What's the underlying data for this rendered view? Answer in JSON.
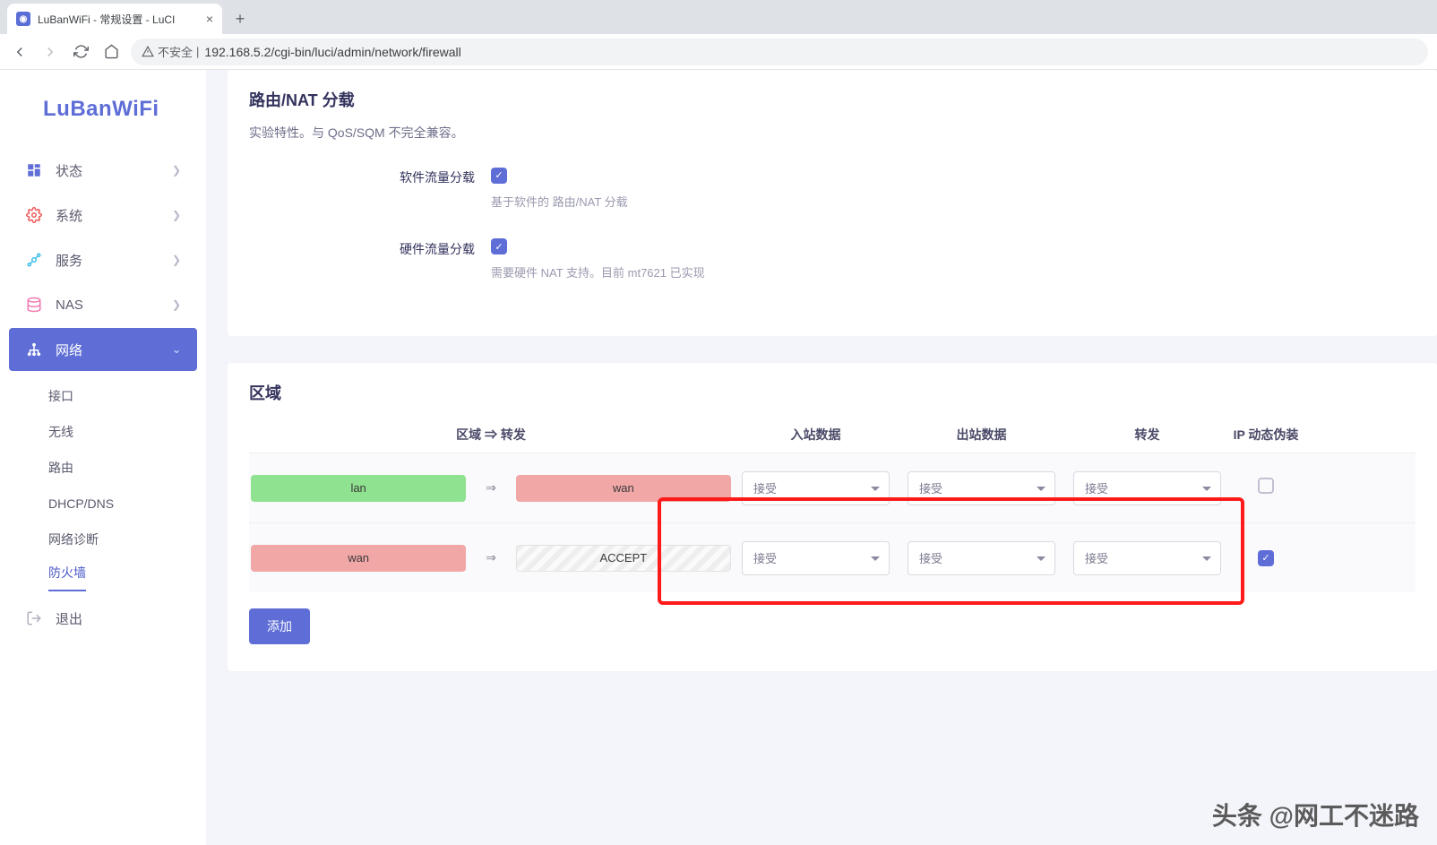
{
  "browser": {
    "tab_title": "LuBanWiFi - 常规设置 - LuCI",
    "insecure_label": "不安全",
    "url": "192.168.5.2/cgi-bin/luci/admin/network/firewall"
  },
  "app": {
    "logo": "LuBanWiFi",
    "menu": {
      "status": "状态",
      "system": "系统",
      "services": "服务",
      "nas": "NAS",
      "network": "网络",
      "logout": "退出"
    },
    "submenu": {
      "interfaces": "接口",
      "wireless": "无线",
      "routes": "路由",
      "dhcpdns": "DHCP/DNS",
      "diagnostics": "网络诊断",
      "firewall": "防火墙"
    }
  },
  "offload": {
    "title": "路由/NAT 分载",
    "desc": "实验特性。与 QoS/SQM 不完全兼容。",
    "sw_label": "软件流量分载",
    "sw_help": "基于软件的 路由/NAT 分载",
    "hw_label": "硬件流量分载",
    "hw_help": "需要硬件 NAT 支持。目前 mt7621 已实现"
  },
  "zones": {
    "title": "区域",
    "headers": {
      "zone_forward": "区域 ⇒ 转发",
      "input": "入站数据",
      "output": "出站数据",
      "forward": "转发",
      "masq": "IP 动态伪装"
    },
    "rows": [
      {
        "from": "lan",
        "from_class": "zlan",
        "to": "wan",
        "to_class": "zwan",
        "input": "接受",
        "output": "接受",
        "forward": "接受",
        "masq": false
      },
      {
        "from": "wan",
        "from_class": "zwan",
        "to": "ACCEPT",
        "to_class": "zaccept",
        "input": "接受",
        "output": "接受",
        "forward": "接受",
        "masq": true
      }
    ],
    "arrow": "⇒",
    "add_btn": "添加"
  },
  "watermark": "头条 @网工不迷路"
}
